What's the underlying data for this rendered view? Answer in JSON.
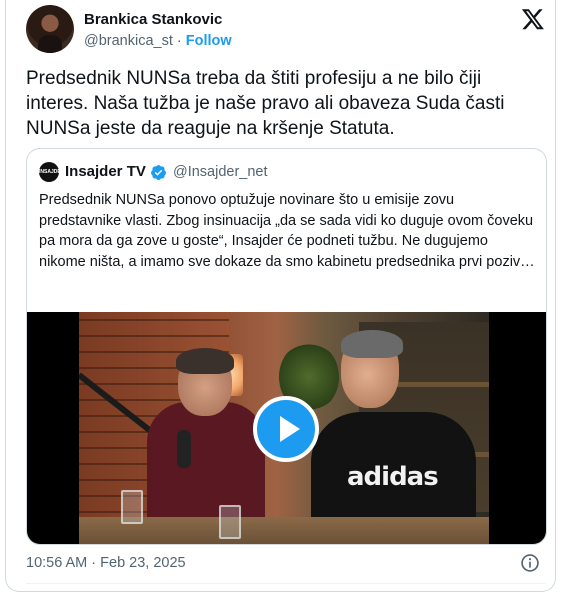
{
  "author": {
    "name": "Brankica Stankovic",
    "handle": "@brankica_st",
    "separator": "·",
    "follow_label": "Follow"
  },
  "tweet": {
    "text": "Predsednik NUNSa treba da štiti profesiju a ne bilo čiji interes. Naša tužba je naše pravo ali obaveza Suda časti NUNSa jeste da reaguje na kršenje Statuta."
  },
  "quote": {
    "avatar_text": "INSAJDER",
    "name": "Insajder TV",
    "handle": "@Insajder_net",
    "text": "Predsednik NUNSa ponovo optužuje novinare što u emisije zovu predstavnike vlasti. Zbog insinuacija „da se sada vidi ko duguje ovom čoveku pa mora da ga zove u goste“, Insajder će podneti tužbu. Ne dugujemo nikome ništa, a imamo sve dokaze da smo kabinetu predsednika prvi poziv…",
    "video": {
      "shirt_print": "adidas",
      "play_icon": "play-icon"
    }
  },
  "meta": {
    "timestamp": "10:56 AM · Feb 23, 2025",
    "info_icon": "info-icon"
  },
  "colors": {
    "accent": "#1d9bf0",
    "text_primary": "#0f1419",
    "text_secondary": "#536471",
    "border": "#cfd9de"
  }
}
